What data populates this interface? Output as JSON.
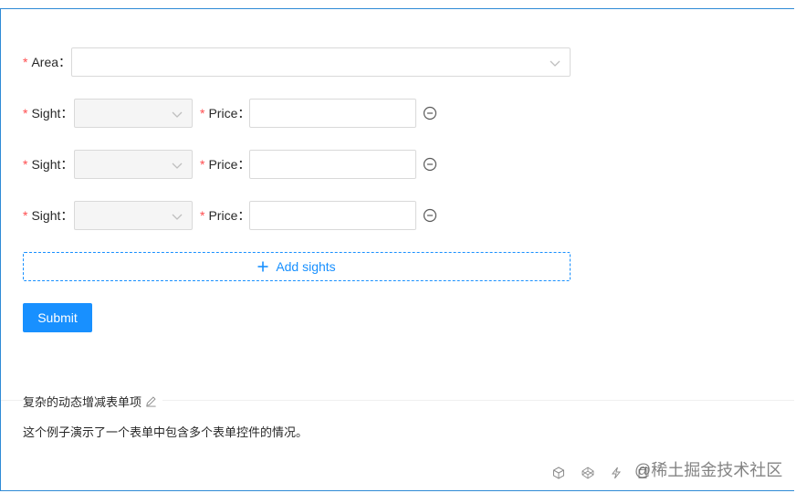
{
  "form": {
    "area": {
      "label": "Area",
      "value": ""
    },
    "colon": "：",
    "sights": [
      {
        "sight_label": "Sight",
        "price_label": "Price",
        "price_value": ""
      },
      {
        "sight_label": "Sight",
        "price_label": "Price",
        "price_value": ""
      },
      {
        "sight_label": "Sight",
        "price_label": "Price",
        "price_value": ""
      }
    ],
    "add_button": "Add sights",
    "submit_button": "Submit"
  },
  "description": {
    "title": "复杂的动态增减表单项",
    "text": "这个例子演示了一个表单中包含多个表单控件的情况。"
  },
  "watermark": "@稀土掘金技术社区",
  "colors": {
    "primary": "#1890ff",
    "required": "#ff4d4f",
    "border": "#d9d9d9",
    "frame": "#2f8bd6"
  },
  "icons": [
    "chevron-down-icon",
    "minus-circle-icon",
    "plus-icon",
    "edit-icon",
    "codesandbox-icon",
    "codepen-icon",
    "thunder-icon",
    "copy-icon"
  ]
}
